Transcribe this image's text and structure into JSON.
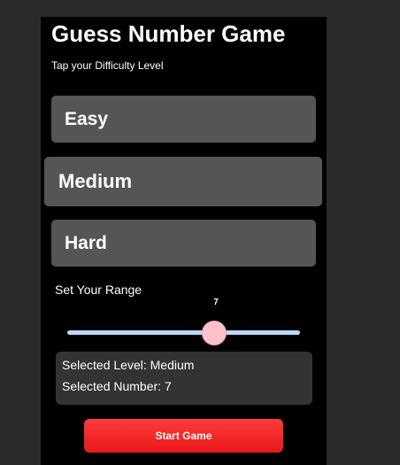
{
  "header": {
    "title": "Guess Number Game",
    "subtitle": "Tap your Difficulty Level"
  },
  "levels": [
    {
      "label": "Easy"
    },
    {
      "label": "Medium",
      "selected": true
    },
    {
      "label": "Hard"
    }
  ],
  "range": {
    "label": "Set Your Range",
    "value": "7",
    "fraction": 0.63
  },
  "info": {
    "level_text": "Selected Level: Medium",
    "number_text": "Selected Number: 7"
  },
  "start_button": {
    "label": "Start Game"
  },
  "colors": {
    "page_background": "#2b2b2b",
    "app_background": "#000000",
    "button_gray": "#555555",
    "slider_track": "#bcd9f7",
    "slider_thumb": "#ffc0cb",
    "start_button": "#ff2a2a"
  }
}
